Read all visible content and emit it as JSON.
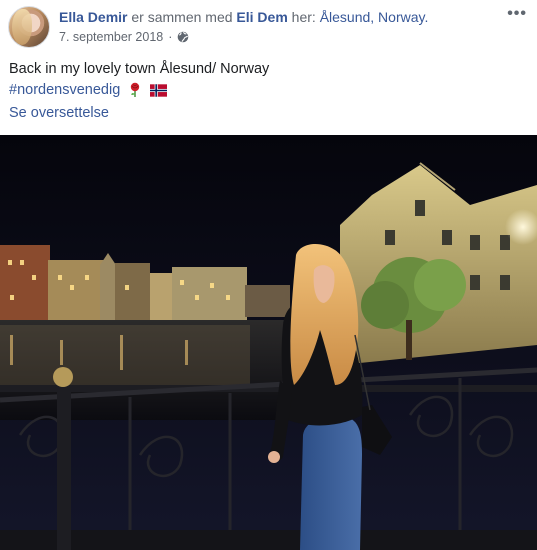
{
  "post": {
    "author": "Ella Demir",
    "with_text": "er sammen med",
    "tagged": "Eli Dem",
    "here_text": "her:",
    "location": "Ålesund, Norway.",
    "date": "7. september 2018",
    "privacy_icon": "globe-icon",
    "more_icon": "more-options-icon",
    "body_line1": "Back in my lovely town Ålesund/ Norway",
    "hashtag": "#nordensvenedig",
    "emojis": [
      "rose",
      "flag-norway"
    ],
    "translate_link": "Se oversettelse",
    "more_glyph": "•••"
  },
  "colors": {
    "link": "#385898",
    "meta": "#616770",
    "text": "#1c1e21"
  }
}
